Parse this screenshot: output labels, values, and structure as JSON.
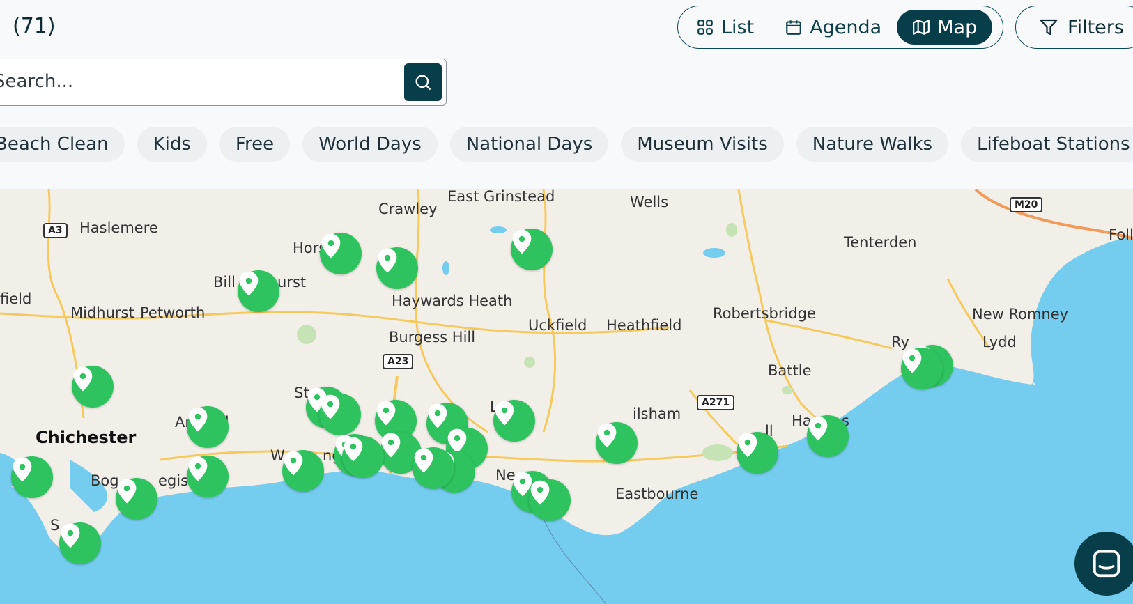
{
  "header": {
    "count": "(71)"
  },
  "view_toggle": {
    "list_label": "List",
    "agenda_label": "Agenda",
    "map_label": "Map",
    "active": "Map"
  },
  "filters": {
    "label": "Filters"
  },
  "search": {
    "placeholder": "Search..."
  },
  "chips": [
    "Beach Clean",
    "Kids",
    "Free",
    "World Days",
    "National Days",
    "Museum Visits",
    "Nature Walks",
    "Lifeboat Stations"
  ],
  "map": {
    "places": [
      "East Grinstead",
      "Wells",
      "Crawley",
      "Haslemere",
      "Hors",
      "Tenterden",
      "Foll",
      "Bill",
      "urst",
      "field",
      "Midhurst",
      "Petworth",
      "Haywards Heath",
      "Uckfield",
      "Heathfield",
      "Robertsbridge",
      "New Romney",
      "Burgess Hill",
      "Lydd",
      "Ry",
      "Battle",
      "St",
      "L",
      "ilsham",
      "Ar",
      "el",
      "Chichester",
      "Ha",
      "s",
      "ll",
      "W",
      "ng",
      "Ne",
      "Bog",
      "egis",
      "Eastbourne",
      "S"
    ],
    "roads": [
      "A3",
      "M20",
      "A23",
      "A271"
    ],
    "colors": {
      "land": "#f2efe9",
      "sea": "#74cdef",
      "pin": "#2ec35f",
      "road_major": "#f6c95c",
      "road_motorway": "#f39a5a"
    }
  },
  "colors": {
    "accent": "#073e49"
  }
}
